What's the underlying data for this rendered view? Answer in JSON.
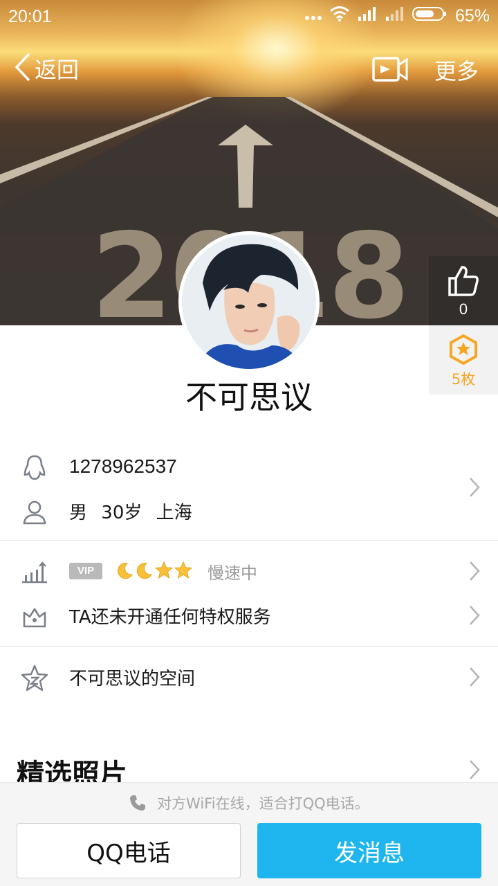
{
  "status_bar": {
    "time": "20:01",
    "battery_percent": "65%"
  },
  "header": {
    "back_label": "返回",
    "more_label": "更多",
    "icons": [
      "back-chevron-icon",
      "video-call-icon"
    ],
    "cover_text": "2018"
  },
  "side_actions": {
    "like_count": "0",
    "medal_count": "5枚"
  },
  "profile": {
    "nickname": "不可思议"
  },
  "info": {
    "qq_number": "1278962537",
    "gender": "男",
    "age": "30岁",
    "location": "上海",
    "vip_badge": "VIP",
    "level_status": "慢速中",
    "privilege_text": "TA还未开通任何特权服务",
    "space_text": "不可思议的空间"
  },
  "photos": {
    "title": "精选照片"
  },
  "bottom_bar": {
    "hint": "对方WiFi在线，适合打QQ电话。",
    "call_label": "QQ电话",
    "message_label": "发消息"
  },
  "colors": {
    "accent_blue": "#1fb5ee",
    "medal_orange": "#f5a623",
    "divider": "#e3e3e3",
    "muted_text": "#9a9a9a"
  }
}
